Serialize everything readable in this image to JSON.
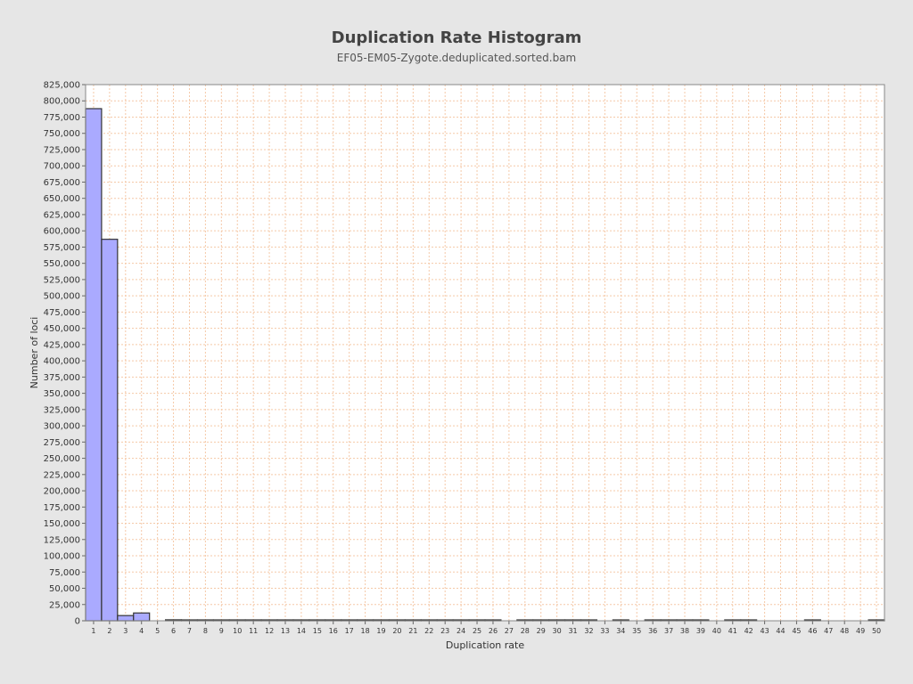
{
  "chart_data": {
    "type": "bar",
    "title": "Duplication Rate Histogram",
    "subtitle": "EF05-EM05-Zygote.deduplicated.sorted.bam",
    "xlabel": "Duplication rate",
    "ylabel": "Number of loci",
    "ylim": [
      0,
      825000
    ],
    "ytick_step": 25000,
    "grid": true,
    "categories": [
      "1",
      "2",
      "3",
      "4",
      "5",
      "6",
      "7",
      "8",
      "9",
      "10",
      "11",
      "12",
      "13",
      "14",
      "15",
      "16",
      "17",
      "18",
      "19",
      "20",
      "21",
      "22",
      "23",
      "24",
      "25",
      "26",
      "27",
      "28",
      "29",
      "30",
      "31",
      "32",
      "33",
      "34",
      "35",
      "36",
      "37",
      "38",
      "39",
      "40",
      "41",
      "42",
      "43",
      "44",
      "45",
      "46",
      "47",
      "48",
      "49",
      "50"
    ],
    "values": [
      788000,
      587000,
      8000,
      12000,
      0,
      1500,
      500,
      400,
      300,
      300,
      200,
      200,
      150,
      150,
      150,
      100,
      100,
      100,
      100,
      100,
      100,
      100,
      80,
      80,
      80,
      80,
      0,
      60,
      60,
      60,
      50,
      50,
      0,
      40,
      0,
      40,
      40,
      40,
      40,
      0,
      30,
      30,
      0,
      0,
      0,
      30,
      0,
      0,
      0,
      800
    ],
    "bar_color": "#aaaaff",
    "bar_edge_color": "#333333",
    "grid_color": "#f5c9a8",
    "plot_bg": "#ffffff",
    "page_bg": "#e6e6e6"
  }
}
